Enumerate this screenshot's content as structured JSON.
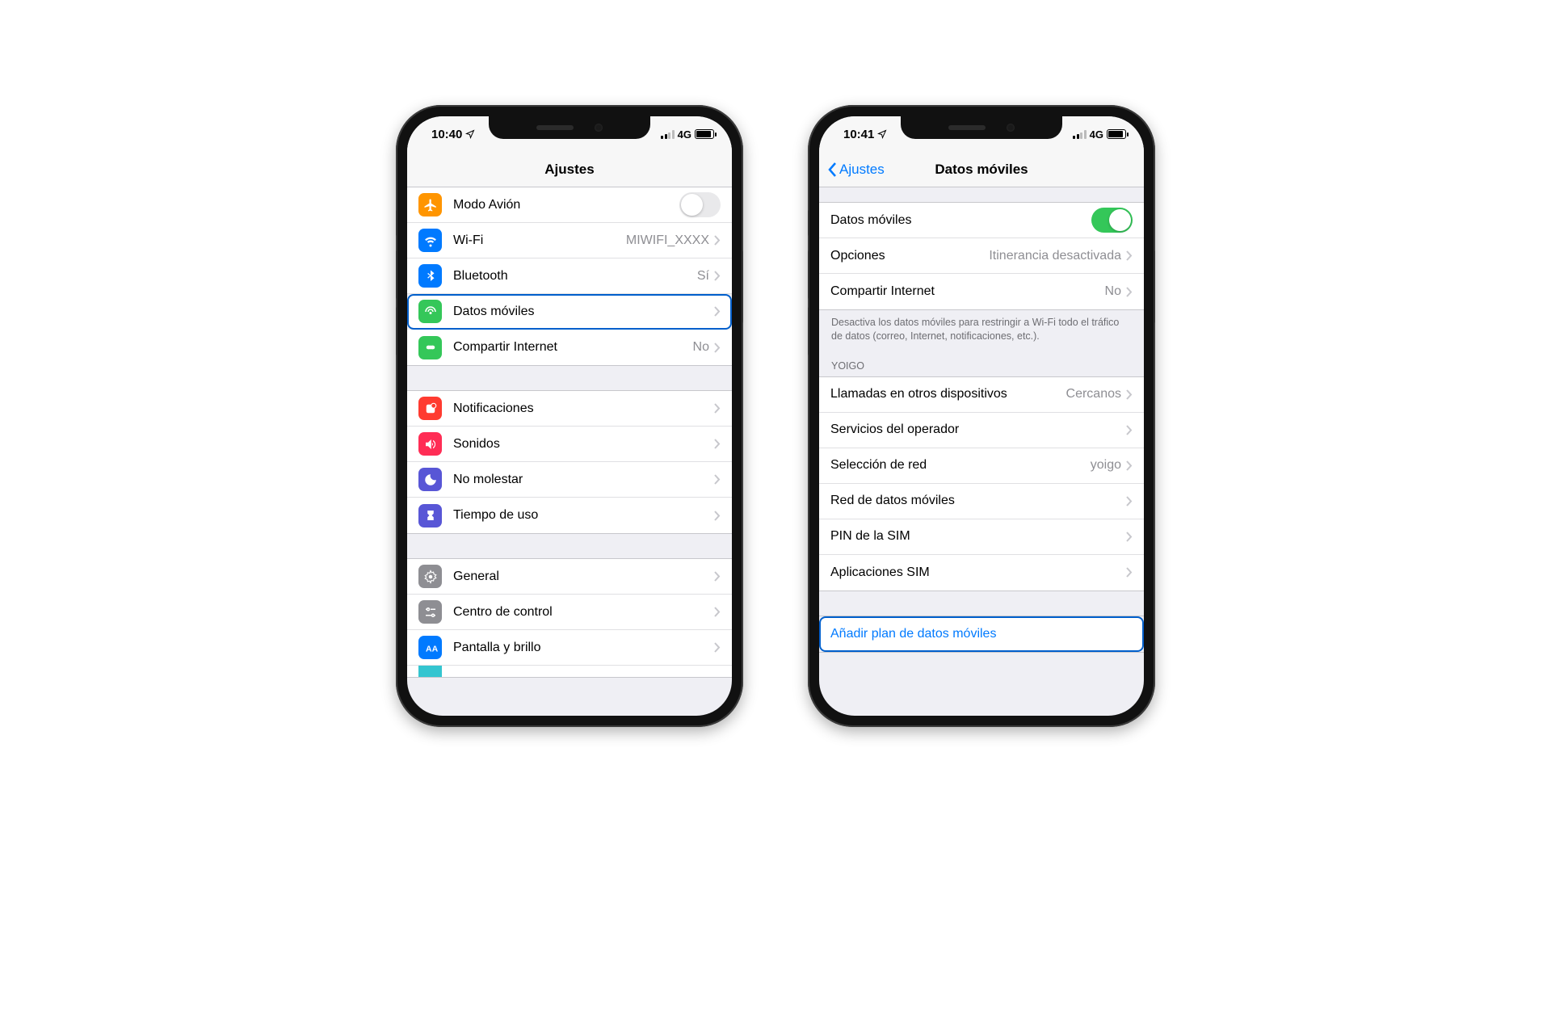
{
  "phone1": {
    "status": {
      "time": "10:40",
      "network": "4G"
    },
    "nav": {
      "title": "Ajustes"
    },
    "rows": {
      "airplane": {
        "label": "Modo Avión"
      },
      "wifi": {
        "label": "Wi-Fi",
        "value": "MIWIFI_XXXX"
      },
      "bluetooth": {
        "label": "Bluetooth",
        "value": "Sí"
      },
      "cellular": {
        "label": "Datos móviles"
      },
      "hotspot": {
        "label": "Compartir Internet",
        "value": "No"
      },
      "notifications": {
        "label": "Notificaciones"
      },
      "sounds": {
        "label": "Sonidos"
      },
      "dnd": {
        "label": "No molestar"
      },
      "screentime": {
        "label": "Tiempo de uso"
      },
      "general": {
        "label": "General"
      },
      "control": {
        "label": "Centro de control"
      },
      "display": {
        "label": "Pantalla y brillo"
      }
    }
  },
  "phone2": {
    "status": {
      "time": "10:41",
      "network": "4G"
    },
    "nav": {
      "back": "Ajustes",
      "title": "Datos móviles"
    },
    "rows": {
      "cellular_data": {
        "label": "Datos móviles"
      },
      "options": {
        "label": "Opciones",
        "value": "Itinerancia desactivada"
      },
      "hotspot": {
        "label": "Compartir Internet",
        "value": "No"
      },
      "calls_other": {
        "label": "Llamadas en otros dispositivos",
        "value": "Cercanos"
      },
      "carrier_svc": {
        "label": "Servicios del operador"
      },
      "network_sel": {
        "label": "Selección de red",
        "value": "yoigo"
      },
      "data_net": {
        "label": "Red de datos móviles"
      },
      "sim_pin": {
        "label": "PIN de la SIM"
      },
      "sim_apps": {
        "label": "Aplicaciones SIM"
      },
      "add_plan": {
        "label": "Añadir plan de datos móviles"
      }
    },
    "footer": "Desactiva los datos móviles para restringir a Wi-Fi todo el tráfico de datos (correo, Internet, notificaciones, etc.).",
    "section_header": "YOIGO"
  },
  "colors": {
    "airplane": "#ff9500",
    "wifi": "#007aff",
    "bluetooth": "#007aff",
    "cellular": "#34c759",
    "hotspot": "#34c759",
    "notifications": "#ff3b30",
    "sounds": "#ff2d55",
    "dnd": "#5856d6",
    "screentime": "#5856d6",
    "general": "#8e8e93",
    "control": "#8e8e93",
    "display": "#007aff"
  }
}
